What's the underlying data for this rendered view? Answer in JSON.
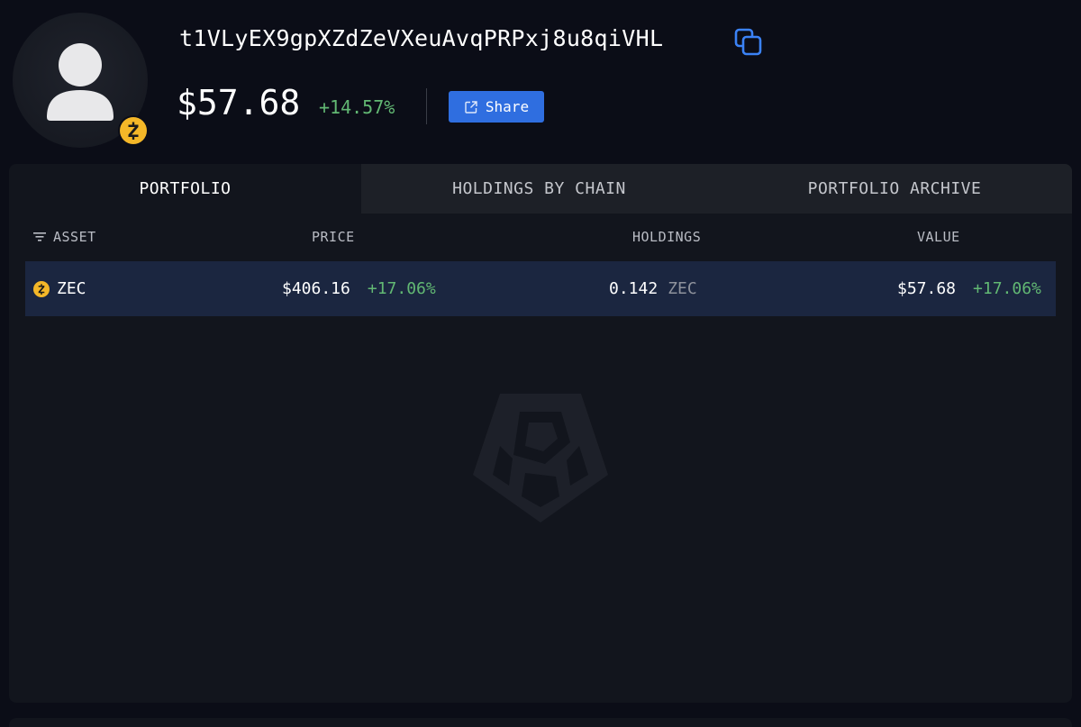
{
  "profile": {
    "avatar_icon": "user-silhouette-icon",
    "chain_badge_icon": "zcash-icon",
    "address": "t1VLyEX9gpXZdZeVXeuAvqPRPxj8u8qiVHL",
    "copy_icon": "copy-icon",
    "total_value": "$57.68",
    "total_change": "+14.57%",
    "share_label": "Share",
    "share_icon": "external-link-icon"
  },
  "tabs": [
    {
      "label": "PORTFOLIO",
      "active": true
    },
    {
      "label": "HOLDINGS BY CHAIN",
      "active": false
    },
    {
      "label": "PORTFOLIO ARCHIVE",
      "active": false
    }
  ],
  "table": {
    "filter_icon": "filter-icon",
    "columns": {
      "asset": "ASSET",
      "price": "PRICE",
      "holdings": "HOLDINGS",
      "value": "VALUE"
    },
    "rows": [
      {
        "asset_icon": "zcash-icon",
        "asset": "ZEC",
        "price": "$406.16",
        "price_change": "+17.06%",
        "holdings_amount": "0.142",
        "holdings_unit": "ZEC",
        "value": "$57.68",
        "value_change": "+17.06%"
      }
    ]
  },
  "watermark_icon": "arkham-logo-icon",
  "colors": {
    "background": "#0b0d17",
    "panel": "#12151d",
    "positive": "#62b873",
    "accent": "#2f6ee0",
    "row_highlight": "#1b2640",
    "zcash_gold": "#f4b728"
  }
}
